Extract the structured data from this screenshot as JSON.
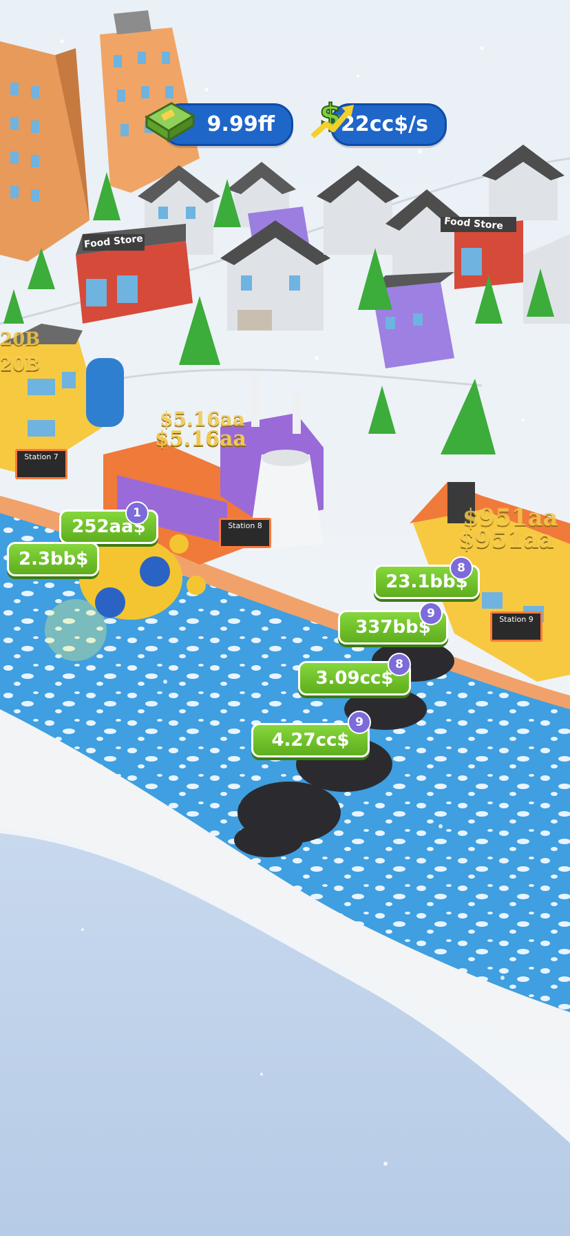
{
  "hud": {
    "cash": "9.99ff",
    "income": "722cc$/s"
  },
  "earnings_tags": [
    {
      "label": "252aa$",
      "badge": "1"
    },
    {
      "label": "2.3bb$",
      "badge": ""
    },
    {
      "label": "23.1bb$",
      "badge": "8"
    },
    {
      "label": "337bb$",
      "badge": "9"
    },
    {
      "label": "3.09cc$",
      "badge": "8"
    },
    {
      "label": "4.27cc$",
      "badge": "9"
    }
  ],
  "floating_income": [
    {
      "text": "$5.16aa"
    },
    {
      "text": "$5.16aa"
    },
    {
      "text": "$951aa"
    },
    {
      "text": "$951aa"
    },
    {
      "text": "20B"
    },
    {
      "text": "20B"
    }
  ],
  "signs": {
    "food_store_1": "Food Store",
    "food_store_2": "Food Store",
    "station_7": "Station 7",
    "station_8": "Station 8",
    "station_9": "Station 9"
  },
  "colors": {
    "hud_blue": "#1f66c9",
    "tag_green": "#6cc22a",
    "badge_purple": "#7c6bd9",
    "river": "#4aa8e6"
  }
}
